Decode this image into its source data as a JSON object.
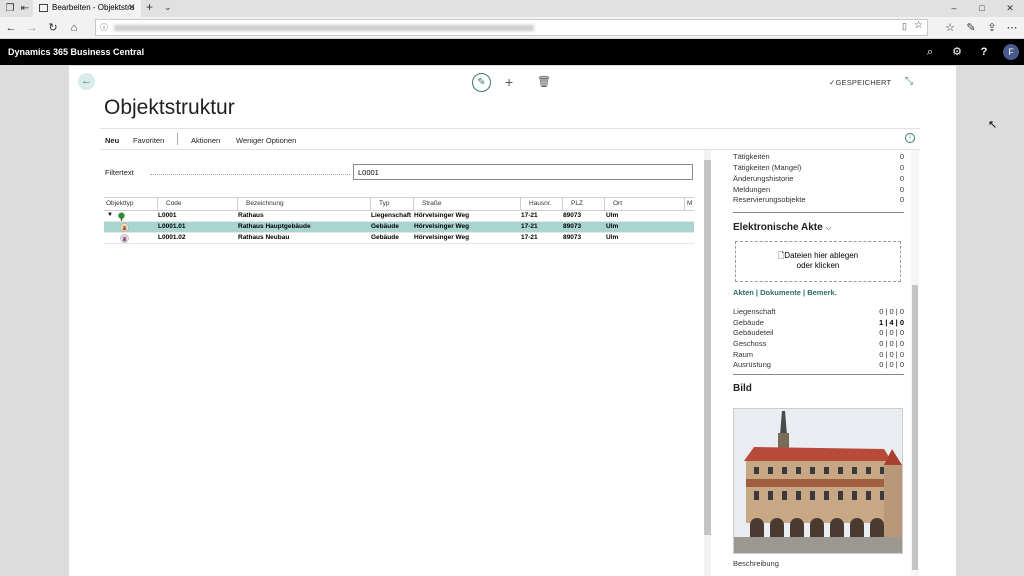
{
  "browser": {
    "tab_title": "Bearbeiten - Objektstru",
    "new_tab": "+",
    "window_controls": [
      "–",
      "□",
      "✕"
    ]
  },
  "app": {
    "title": "Dynamics 365 Business Central",
    "user_initial": "F"
  },
  "page": {
    "title": "Objektstruktur",
    "saved_status": "GESPEICHERT",
    "actions": [
      "Neu",
      "Favoriten",
      "Aktionen",
      "Weniger Optionen"
    ],
    "filter_label": "Filtertext",
    "filter_value": "L0001"
  },
  "table": {
    "columns": [
      "Objekttyp",
      "Code",
      "Bezeichnung",
      "Typ",
      "Straße",
      "Hausnr.",
      "PLZ",
      "Ort",
      "M"
    ],
    "rows": [
      {
        "code": "L0001",
        "bezeichnung": "Rathaus",
        "typ": "Liegenschaft",
        "strasse": "Hörvelsinger Weg",
        "hausnr": "17-21",
        "plz": "89073",
        "ort": "Ulm",
        "icon": "tree-icon",
        "expanded": true,
        "selected": false
      },
      {
        "code": "L0001.01",
        "bezeichnung": "Rathaus Hauptgebäude",
        "typ": "Gebäude",
        "strasse": "Hörvelsinger Weg",
        "hausnr": "17-21",
        "plz": "89073",
        "ort": "Ulm",
        "icon": "building-icon",
        "expanded": false,
        "selected": true
      },
      {
        "code": "L0001.02",
        "bezeichnung": "Rathaus Neubau",
        "typ": "Gebäude",
        "strasse": "Hörvelsinger Weg",
        "hausnr": "17-21",
        "plz": "89073",
        "ort": "Ulm",
        "icon": "building-icon",
        "expanded": false,
        "selected": false
      }
    ]
  },
  "factbox": {
    "counts": [
      {
        "label": "Tätigkeiten",
        "value": "0"
      },
      {
        "label": "Tätigkeiten (Mangel)",
        "value": "0"
      },
      {
        "label": "Änderungshistorie",
        "value": "0"
      },
      {
        "label": "Meldungen",
        "value": "0"
      },
      {
        "label": "Reservierungsobjekte",
        "value": "0"
      }
    ],
    "akte_title": "Elektronische Akte",
    "drop_line1": "Dateien hier ablegen",
    "drop_line2": "oder klicken",
    "akten_links": "Akten | Dokumente | Bemerk.",
    "akte_rows": [
      {
        "label": "Liegenschaft",
        "value": "0 | 0 | 0",
        "bold": false
      },
      {
        "label": "Gebäude",
        "value": "1 | 4 | 0",
        "bold": true
      },
      {
        "label": "Gebäudeteil",
        "value": "0 | 0 | 0",
        "bold": false
      },
      {
        "label": "Geschoss",
        "value": "0 | 0 | 0",
        "bold": false
      },
      {
        "label": "Raum",
        "value": "0 | 0 | 0",
        "bold": false
      },
      {
        "label": "Ausrüstung",
        "value": "0 | 0 | 0",
        "bold": false
      }
    ],
    "bild_title": "Bild",
    "beschreibung": "Beschreibung"
  },
  "colors": {
    "accent": "#3a7a72",
    "selected_row": "#a8d5cd",
    "header_bg": "#000000"
  }
}
